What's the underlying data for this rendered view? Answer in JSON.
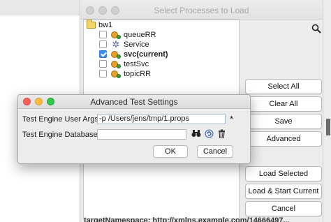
{
  "main_window": {
    "title": "Select Processes to Load",
    "tree": {
      "root": "bw1",
      "items": [
        {
          "label": "queueRR",
          "checked": false,
          "bold": false,
          "icon": "process-gear-icon"
        },
        {
          "label": "Service",
          "checked": false,
          "bold": false,
          "icon": "service-icon"
        },
        {
          "label": "svc(current)",
          "checked": true,
          "bold": true,
          "icon": "process-gear-icon"
        },
        {
          "label": "testSvc",
          "checked": false,
          "bold": false,
          "icon": "process-gear-icon"
        },
        {
          "label": "topicRR",
          "checked": false,
          "bold": false,
          "icon": "process-gear-icon"
        }
      ]
    },
    "buttons": {
      "select_all": "Select All",
      "clear_all": "Clear All",
      "save": "Save",
      "advanced": "Advanced",
      "load_selected": "Load Selected",
      "load_start_current": "Load & Start Current",
      "cancel": "Cancel"
    }
  },
  "dialog": {
    "title": "Advanced Test Settings",
    "user_args_label": "Test Engine User Args:",
    "user_args_value": "-p /Users/jens/tmp/1.props",
    "database_label": "Test Engine Database:",
    "database_value": "",
    "required_marker": "*",
    "ok": "OK",
    "cancel": "Cancel"
  },
  "background": {
    "bottom_text": "targetNamespace: http://xmlns.example.com/14666497..."
  }
}
